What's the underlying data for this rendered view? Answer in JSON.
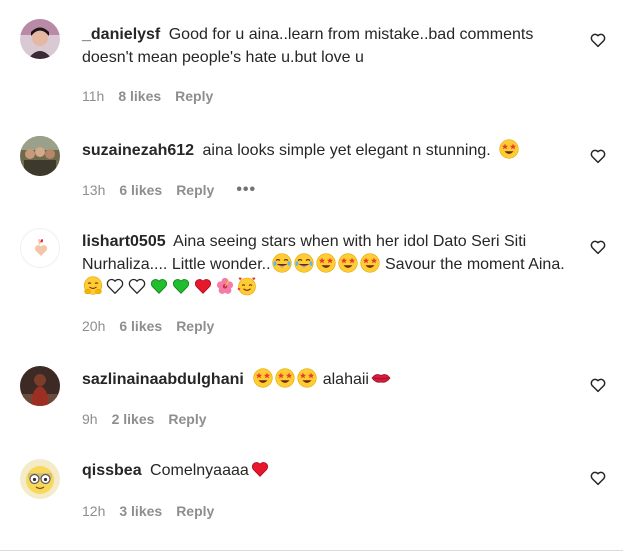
{
  "comments": [
    {
      "username": "_danielysf",
      "text": "Good for u aina..learn from mistake..bad comments doesn't mean people's hate u.but love u",
      "time": "11h",
      "likes": "8 likes",
      "reply": "Reply"
    },
    {
      "username": "suzainezah612",
      "text": "aina looks simple yet elegant n stunning.",
      "time": "13h",
      "likes": "6 likes",
      "reply": "Reply",
      "more": "•••"
    },
    {
      "username": "lishart0505",
      "text_a": "Aina seeing stars when with her idol Dato Seri Siti Nurhaliza.... Little wonder..",
      "text_b": "Savour the moment Aina.",
      "time": "20h",
      "likes": "6 likes",
      "reply": "Reply"
    },
    {
      "username": "sazlinainaabdulghani",
      "text": "alahaii",
      "time": "9h",
      "likes": "2 likes",
      "reply": "Reply"
    },
    {
      "username": "qissbea",
      "text": "Comelnyaaaa",
      "time": "12h",
      "likes": "3 likes",
      "reply": "Reply"
    }
  ],
  "icons": {
    "like": "heart-outline-icon",
    "emoji_star_eyes": "star-struck-emoji",
    "emoji_heart_eyes": "heart-eyes-emoji",
    "emoji_joy": "tears-of-joy-emoji",
    "emoji_hug": "hugging-emoji",
    "emoji_white_heart": "white-heart-emoji",
    "emoji_green_heart": "green-heart-emoji",
    "emoji_red_heart": "red-heart-emoji",
    "emoji_hibiscus": "hibiscus-emoji",
    "emoji_smiling_hearts": "smiling-face-with-hearts-emoji",
    "emoji_lips": "kiss-lips-emoji"
  },
  "colors": {
    "text": "#262626",
    "meta": "#8e8e8e",
    "heart_red": "#e0245e",
    "green_heart": "#1fbf2e",
    "emoji_yellow": "#ffcc33"
  }
}
